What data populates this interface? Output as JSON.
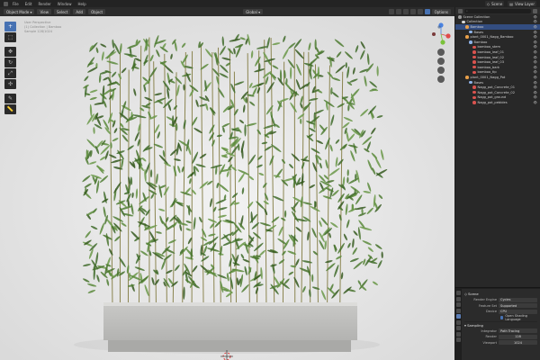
{
  "topbar": {
    "menus": [
      "File",
      "Edit",
      "Render",
      "Window",
      "Help"
    ],
    "scene_label": "Scene",
    "view_layer_label": "View Layer"
  },
  "viewport": {
    "mode": "Object Mode",
    "header_menus": [
      "View",
      "Select",
      "Add",
      "Object"
    ],
    "transform": "Global",
    "options": "Options",
    "info": [
      "User Perspective",
      "(1) Collection | Bamboo",
      "Sample 128/1024"
    ]
  },
  "toolbar": {
    "tools": [
      "cursor-icon",
      "select-box-icon",
      "move-icon",
      "rotate-icon",
      "scale-icon",
      "transform-icon",
      "annotate-icon",
      "measure-icon"
    ]
  },
  "gizmo": {
    "x_color": "#e04a4a",
    "y_color": "#7ac23a",
    "z_color": "#4a82e0",
    "buttons": [
      "zoom-icon",
      "hand-icon",
      "camera-icon",
      "grid-icon"
    ]
  },
  "outliner": {
    "search_placeholder": "",
    "rows": [
      {
        "label": "Scene Collection",
        "indent": 0,
        "icon": "#9a9a9a",
        "selected": false
      },
      {
        "label": "Collection",
        "indent": 1,
        "icon": "#d8d8d8",
        "selected": false
      },
      {
        "label": "Bamboo",
        "indent": 2,
        "icon": "#e8a04a",
        "selected": true
      },
      {
        "label": "Bases",
        "indent": 3,
        "icon": "#8fb3e8",
        "selected": false
      },
      {
        "label": "plant_0001_Nagg_Bamboo",
        "indent": 2,
        "icon": "#e8a04a",
        "selected": false
      },
      {
        "label": "Bamboo",
        "indent": 3,
        "icon": "#8fb3e8",
        "selected": false
      },
      {
        "label": "bamboo_stem",
        "indent": 4,
        "icon": "#d9534f",
        "selected": false
      },
      {
        "label": "bamboo_leaf_01",
        "indent": 4,
        "icon": "#d9534f",
        "selected": false
      },
      {
        "label": "bamboo_leaf_02",
        "indent": 4,
        "icon": "#d9534f",
        "selected": false
      },
      {
        "label": "bamboo_leaf_03",
        "indent": 4,
        "icon": "#d9534f",
        "selected": false
      },
      {
        "label": "bamboo_bark",
        "indent": 4,
        "icon": "#d9534f",
        "selected": false
      },
      {
        "label": "bamboo_tip",
        "indent": 4,
        "icon": "#d9534f",
        "selected": false
      },
      {
        "label": "plant_0001_Nagg_Pot",
        "indent": 2,
        "icon": "#e8a04a",
        "selected": false
      },
      {
        "label": "Bases",
        "indent": 3,
        "icon": "#8fb3e8",
        "selected": false
      },
      {
        "label": "Nagg_pot_Concrete_01",
        "indent": 4,
        "icon": "#d9534f",
        "selected": false
      },
      {
        "label": "Nagg_pot_Concrete_02",
        "indent": 4,
        "icon": "#d9534f",
        "selected": false
      },
      {
        "label": "Nagg_pot_ground",
        "indent": 4,
        "icon": "#d9534f",
        "selected": false
      },
      {
        "label": "Nagg_pot_pebbles",
        "indent": 4,
        "icon": "#d9534f",
        "selected": false
      }
    ]
  },
  "properties": {
    "title": "Scene",
    "render_engine_label": "Render Engine",
    "render_engine": "Cycles",
    "feature_set_label": "Feature Set",
    "feature_set": "Supported",
    "device_label": "Device",
    "device": "CPU",
    "osl_label": "Open Shading Language",
    "sampling_label": "Sampling",
    "integrator_label": "Integrator",
    "integrator": "Path Tracing",
    "render_label": "Render",
    "render_samples": "128",
    "viewport_label": "Viewport",
    "viewport_samples": "1024"
  }
}
